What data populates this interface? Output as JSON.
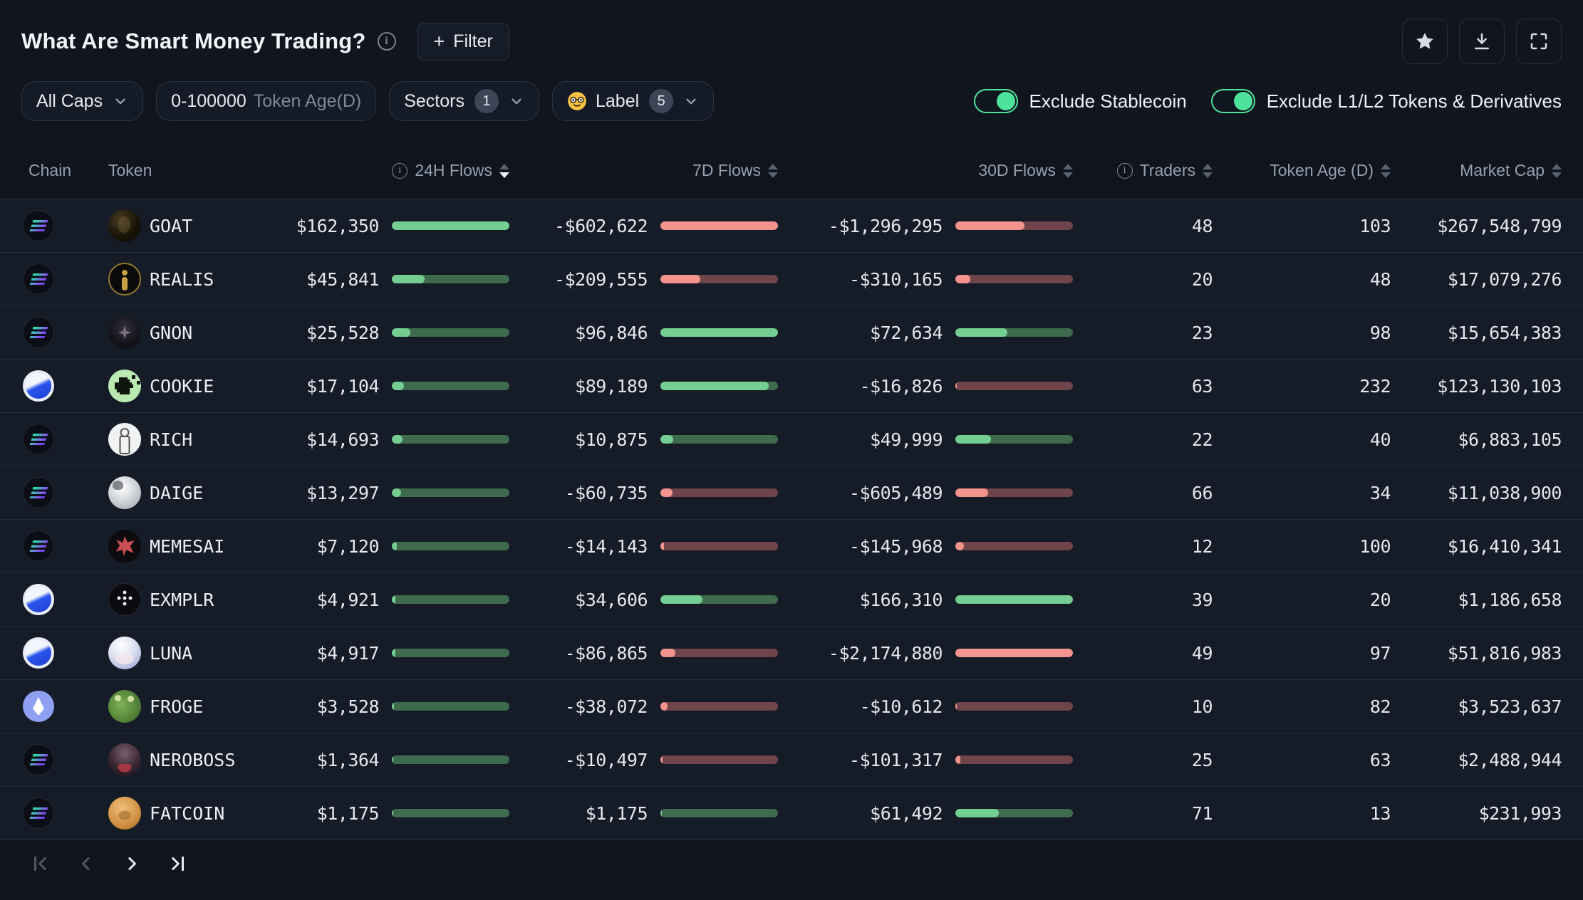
{
  "header": {
    "title": "What Are Smart Money Trading?",
    "filter_button": "Filter"
  },
  "filters": {
    "market_cap": {
      "label": "All Caps"
    },
    "token_age": {
      "value": "0-100000",
      "label": "Token Age(D)"
    },
    "sectors": {
      "label": "Sectors",
      "count": "1"
    },
    "smart_label": {
      "label": "Label",
      "count": "5"
    },
    "exclude_stablecoin": {
      "label": "Exclude Stablecoin",
      "on": true
    },
    "exclude_l1l2": {
      "label": "Exclude L1/L2 Tokens & Derivatives",
      "on": true
    }
  },
  "table": {
    "columns": [
      "Chain",
      "Token",
      "24H Flows",
      "7D Flows",
      "30D Flows",
      "Traders",
      "Token Age (D)",
      "Market Cap"
    ],
    "sorted_column": "24H Flows",
    "sort_direction": "desc",
    "rows": [
      {
        "chain": "solana",
        "token": "GOAT",
        "h24": {
          "value": "$162,350",
          "pct": 100
        },
        "d7": {
          "value": "-$602,622",
          "pct": 100
        },
        "d30": {
          "value": "-$1,296,295",
          "pct": 59
        },
        "traders": "48",
        "age": "103",
        "mcap": "$267,548,799"
      },
      {
        "chain": "solana",
        "token": "REALIS",
        "h24": {
          "value": "$45,841",
          "pct": 28
        },
        "d7": {
          "value": "-$209,555",
          "pct": 34
        },
        "d30": {
          "value": "-$310,165",
          "pct": 13
        },
        "traders": "20",
        "age": "48",
        "mcap": "$17,079,276"
      },
      {
        "chain": "solana",
        "token": "GNON",
        "h24": {
          "value": "$25,528",
          "pct": 16
        },
        "d7": {
          "value": "$96,846",
          "pct": 100
        },
        "d30": {
          "value": "$72,634",
          "pct": 44
        },
        "traders": "23",
        "age": "98",
        "mcap": "$15,654,383"
      },
      {
        "chain": "base",
        "token": "COOKIE",
        "h24": {
          "value": "$17,104",
          "pct": 10
        },
        "d7": {
          "value": "$89,189",
          "pct": 92
        },
        "d30": {
          "value": "-$16,826",
          "pct": 1
        },
        "traders": "63",
        "age": "232",
        "mcap": "$123,130,103"
      },
      {
        "chain": "solana",
        "token": "RICH",
        "h24": {
          "value": "$14,693",
          "pct": 9
        },
        "d7": {
          "value": "$10,875",
          "pct": 11
        },
        "d30": {
          "value": "$49,999",
          "pct": 30
        },
        "traders": "22",
        "age": "40",
        "mcap": "$6,883,105"
      },
      {
        "chain": "solana",
        "token": "DAIGE",
        "h24": {
          "value": "$13,297",
          "pct": 8
        },
        "d7": {
          "value": "-$60,735",
          "pct": 10
        },
        "d30": {
          "value": "-$605,489",
          "pct": 28
        },
        "traders": "66",
        "age": "34",
        "mcap": "$11,038,900"
      },
      {
        "chain": "solana",
        "token": "MEMESAI",
        "h24": {
          "value": "$7,120",
          "pct": 4
        },
        "d7": {
          "value": "-$14,143",
          "pct": 3
        },
        "d30": {
          "value": "-$145,968",
          "pct": 7
        },
        "traders": "12",
        "age": "100",
        "mcap": "$16,410,341"
      },
      {
        "chain": "base",
        "token": "EXMPLR",
        "h24": {
          "value": "$4,921",
          "pct": 3
        },
        "d7": {
          "value": "$34,606",
          "pct": 36
        },
        "d30": {
          "value": "$166,310",
          "pct": 100
        },
        "traders": "39",
        "age": "20",
        "mcap": "$1,186,658"
      },
      {
        "chain": "base",
        "token": "LUNA",
        "h24": {
          "value": "$4,917",
          "pct": 3
        },
        "d7": {
          "value": "-$86,865",
          "pct": 13
        },
        "d30": {
          "value": "-$2,174,880",
          "pct": 100
        },
        "traders": "49",
        "age": "97",
        "mcap": "$51,816,983"
      },
      {
        "chain": "ethereum",
        "token": "FROGE",
        "h24": {
          "value": "$3,528",
          "pct": 2
        },
        "d7": {
          "value": "-$38,072",
          "pct": 6
        },
        "d30": {
          "value": "-$10,612",
          "pct": 1
        },
        "traders": "10",
        "age": "82",
        "mcap": "$3,523,637"
      },
      {
        "chain": "solana",
        "token": "NEROBOSS",
        "h24": {
          "value": "$1,364",
          "pct": 1
        },
        "d7": {
          "value": "-$10,497",
          "pct": 2
        },
        "d30": {
          "value": "-$101,317",
          "pct": 4
        },
        "traders": "25",
        "age": "63",
        "mcap": "$2,488,944"
      },
      {
        "chain": "solana",
        "token": "FATCOIN",
        "h24": {
          "value": "$1,175",
          "pct": 1
        },
        "d7": {
          "value": "$1,175",
          "pct": 1
        },
        "d30": {
          "value": "$61,492",
          "pct": 37
        },
        "traders": "71",
        "age": "13",
        "mcap": "$231,993"
      }
    ]
  },
  "colors": {
    "positive_fill": "#74CE92",
    "positive_track": "#3E6A4D",
    "negative_fill": "#F2938D",
    "negative_track": "#6F444A",
    "toggle_on": "#4EE39D"
  }
}
